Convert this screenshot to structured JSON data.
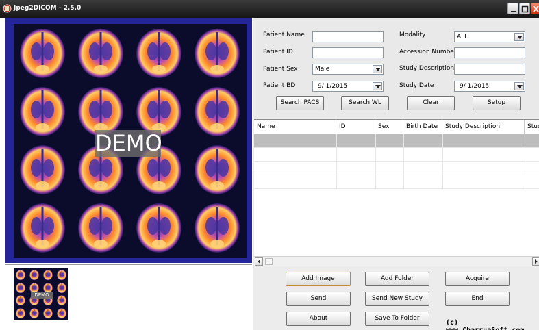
{
  "window": {
    "title": "Jpeg2DICOM - 2.5.0",
    "icons": [
      "app-icon",
      "minimize-icon",
      "maximize-icon",
      "close-icon"
    ]
  },
  "viewer": {
    "watermark": "DEMO",
    "thumbnail_watermark": "DEMO",
    "colors": {
      "frame": "#25259a",
      "background": "#0b0b2c"
    }
  },
  "search": {
    "patient_name": {
      "label": "Patient Name",
      "value": ""
    },
    "patient_id": {
      "label": "Patient ID",
      "value": ""
    },
    "patient_sex": {
      "label": "Patient Sex",
      "value": "Male"
    },
    "patient_bd": {
      "label": "Patient BD",
      "value": "9/ 1/2015"
    },
    "modality": {
      "label": "Modality",
      "value": "ALL"
    },
    "accession_number": {
      "label": "Accession Number",
      "value": ""
    },
    "study_description": {
      "label": "Study Description",
      "value": ""
    },
    "study_date": {
      "label": "Study Date",
      "value": "9/ 1/2015"
    },
    "buttons": {
      "search_pacs": "Search PACS",
      "search_wl": "Search WL",
      "clear": "Clear",
      "setup": "Setup"
    }
  },
  "results": {
    "columns": [
      "Name",
      "ID",
      "Sex",
      "Birth Date",
      "Study Description",
      "Stud"
    ],
    "rows": [
      [
        "",
        "",
        "",
        "",
        "",
        ""
      ],
      [
        "",
        "",
        "",
        "",
        "",
        ""
      ],
      [
        "",
        "",
        "",
        "",
        "",
        ""
      ],
      [
        "",
        "",
        "",
        "",
        "",
        ""
      ]
    ],
    "selected_row": 0
  },
  "actions": {
    "add_image": "Add Image",
    "add_folder": "Add Folder",
    "acquire": "Acquire",
    "send": "Send",
    "send_new_study": "Send New Study",
    "end": "End",
    "about": "About",
    "save_to_folder": "Save To Folder"
  },
  "footer": {
    "copyright": "(c) www.CharruaSoft.com"
  }
}
